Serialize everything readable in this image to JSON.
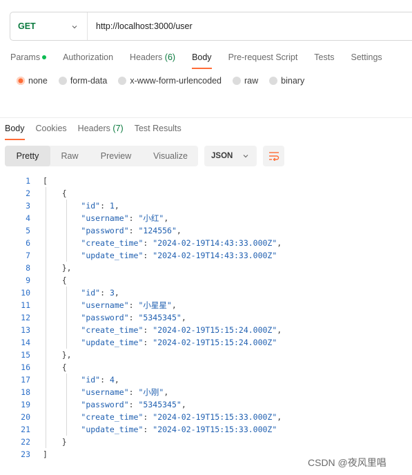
{
  "request": {
    "method": "GET",
    "url": "http://localhost:3000/user"
  },
  "request_tabs": [
    {
      "label": "Params",
      "dot": true
    },
    {
      "label": "Authorization"
    },
    {
      "label": "Headers",
      "count": "(6)"
    },
    {
      "label": "Body",
      "active": true
    },
    {
      "label": "Pre-request Script"
    },
    {
      "label": "Tests"
    },
    {
      "label": "Settings"
    }
  ],
  "body_types": [
    "none",
    "form-data",
    "x-www-form-urlencoded",
    "raw",
    "binary"
  ],
  "body_type_selected": "none",
  "response_tabs": [
    {
      "label": "Body",
      "active": true
    },
    {
      "label": "Cookies"
    },
    {
      "label": "Headers",
      "count": "(7)"
    },
    {
      "label": "Test Results"
    }
  ],
  "view_modes": [
    "Pretty",
    "Raw",
    "Preview",
    "Visualize"
  ],
  "view_mode_selected": "Pretty",
  "format": "JSON",
  "response_json": [
    {
      "id": 1,
      "username": "小红",
      "password": "124556",
      "create_time": "2024-02-19T14:43:33.000Z",
      "update_time": "2024-02-19T14:43:33.000Z"
    },
    {
      "id": 3,
      "username": "小星星",
      "password": "5345345",
      "create_time": "2024-02-19T15:15:24.000Z",
      "update_time": "2024-02-19T15:15:24.000Z"
    },
    {
      "id": 4,
      "username": "小刚",
      "password": "5345345",
      "create_time": "2024-02-19T15:15:33.000Z",
      "update_time": "2024-02-19T15:15:33.000Z"
    }
  ],
  "watermark": "CSDN @夜风里唱",
  "colors": {
    "accent": "#ff6c37",
    "method_get": "#0a7a3e",
    "json_value": "#1f5fb0"
  }
}
